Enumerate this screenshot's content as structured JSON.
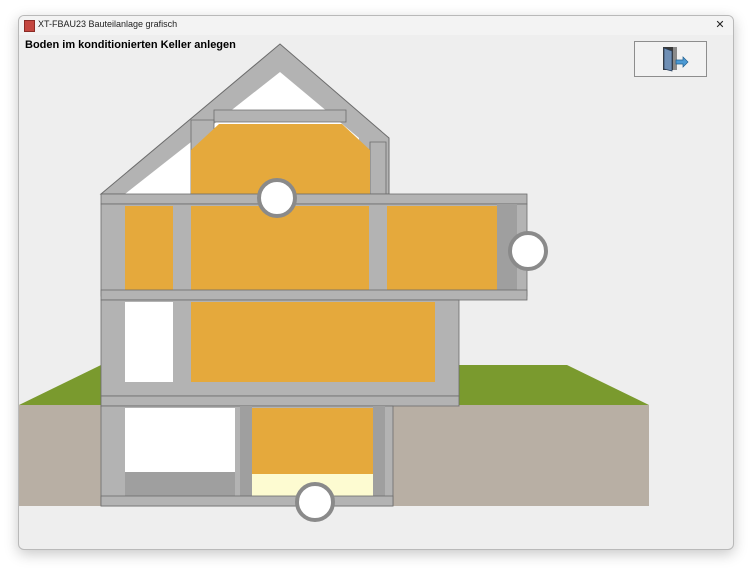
{
  "window": {
    "title": "XT-FBAU23 Bauteilanlage grafisch",
    "close_glyph": "✕"
  },
  "heading": "Boden im konditionierten Keller anlegen",
  "exit_button": {
    "icon": "exit-door-icon"
  },
  "colors": {
    "heated_zone": "#e5a93c",
    "selected_floor": "#fdfbd1",
    "wall": "#b3b3b3",
    "wall_edge": "#6c6c6c",
    "grass": "#7a9a2e",
    "soil": "#b8afa4"
  },
  "markers": [
    {
      "name": "marker-ceiling-top",
      "state": "unselected"
    },
    {
      "name": "marker-side-wall",
      "state": "unselected"
    },
    {
      "name": "marker-cellar-floor",
      "state": "unselected"
    }
  ]
}
